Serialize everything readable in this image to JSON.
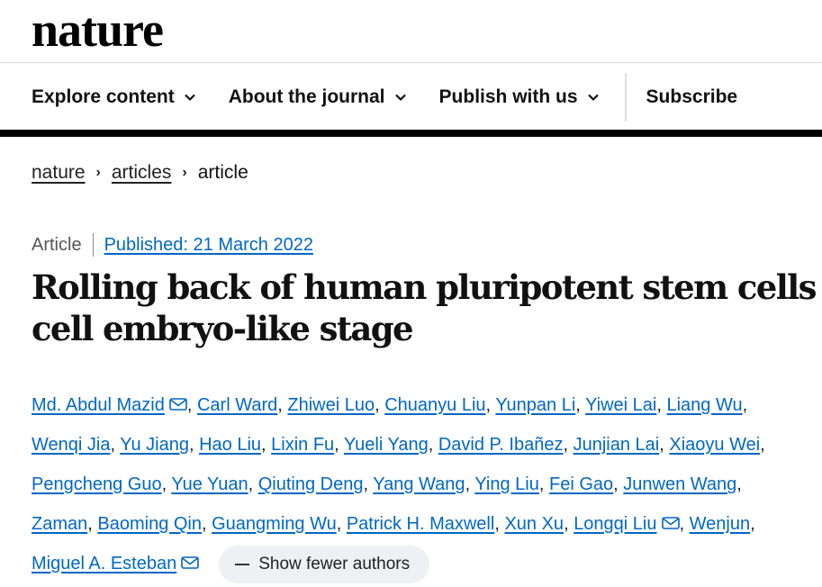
{
  "header": {
    "logo": "nature"
  },
  "nav": {
    "items": [
      {
        "label": "Explore content"
      },
      {
        "label": "About the journal"
      },
      {
        "label": "Publish with us"
      }
    ],
    "subscribe": "Subscribe"
  },
  "breadcrumb": {
    "items": [
      "nature",
      "articles"
    ],
    "current": "article"
  },
  "meta": {
    "type": "Article",
    "published": "Published: 21 March 2022"
  },
  "article": {
    "title_line1": "Rolling back of human pluripotent stem cells to",
    "title_line2": "cell embryo-like stage"
  },
  "authors": {
    "names": [
      "Md. Abdul Mazid",
      "Carl Ward",
      "Zhiwei Luo",
      "Chuanyu Liu",
      "Yunpan Li",
      "Yiwei Lai",
      "Liang Wu",
      "Wenqi Jia",
      "Yu Jiang",
      "Hao Liu",
      "Lixin Fu",
      "Yueli Yang",
      "David P. Ibañez",
      "Junjian Lai",
      "Xiaoyu Wei",
      "Pengcheng Guo",
      "Yue Yuan",
      "Qiuting Deng",
      "Yang Wang",
      "Ying Liu",
      "Fei Gao",
      "Junwen Wang",
      "Zaman",
      "Baoming Qin",
      "Guangming Wu",
      "Patrick H. Maxwell",
      "Xun Xu",
      "Longqi Liu",
      "Wenjun",
      "Miguel A. Esteban"
    ],
    "show_fewer": "Show fewer authors"
  }
}
